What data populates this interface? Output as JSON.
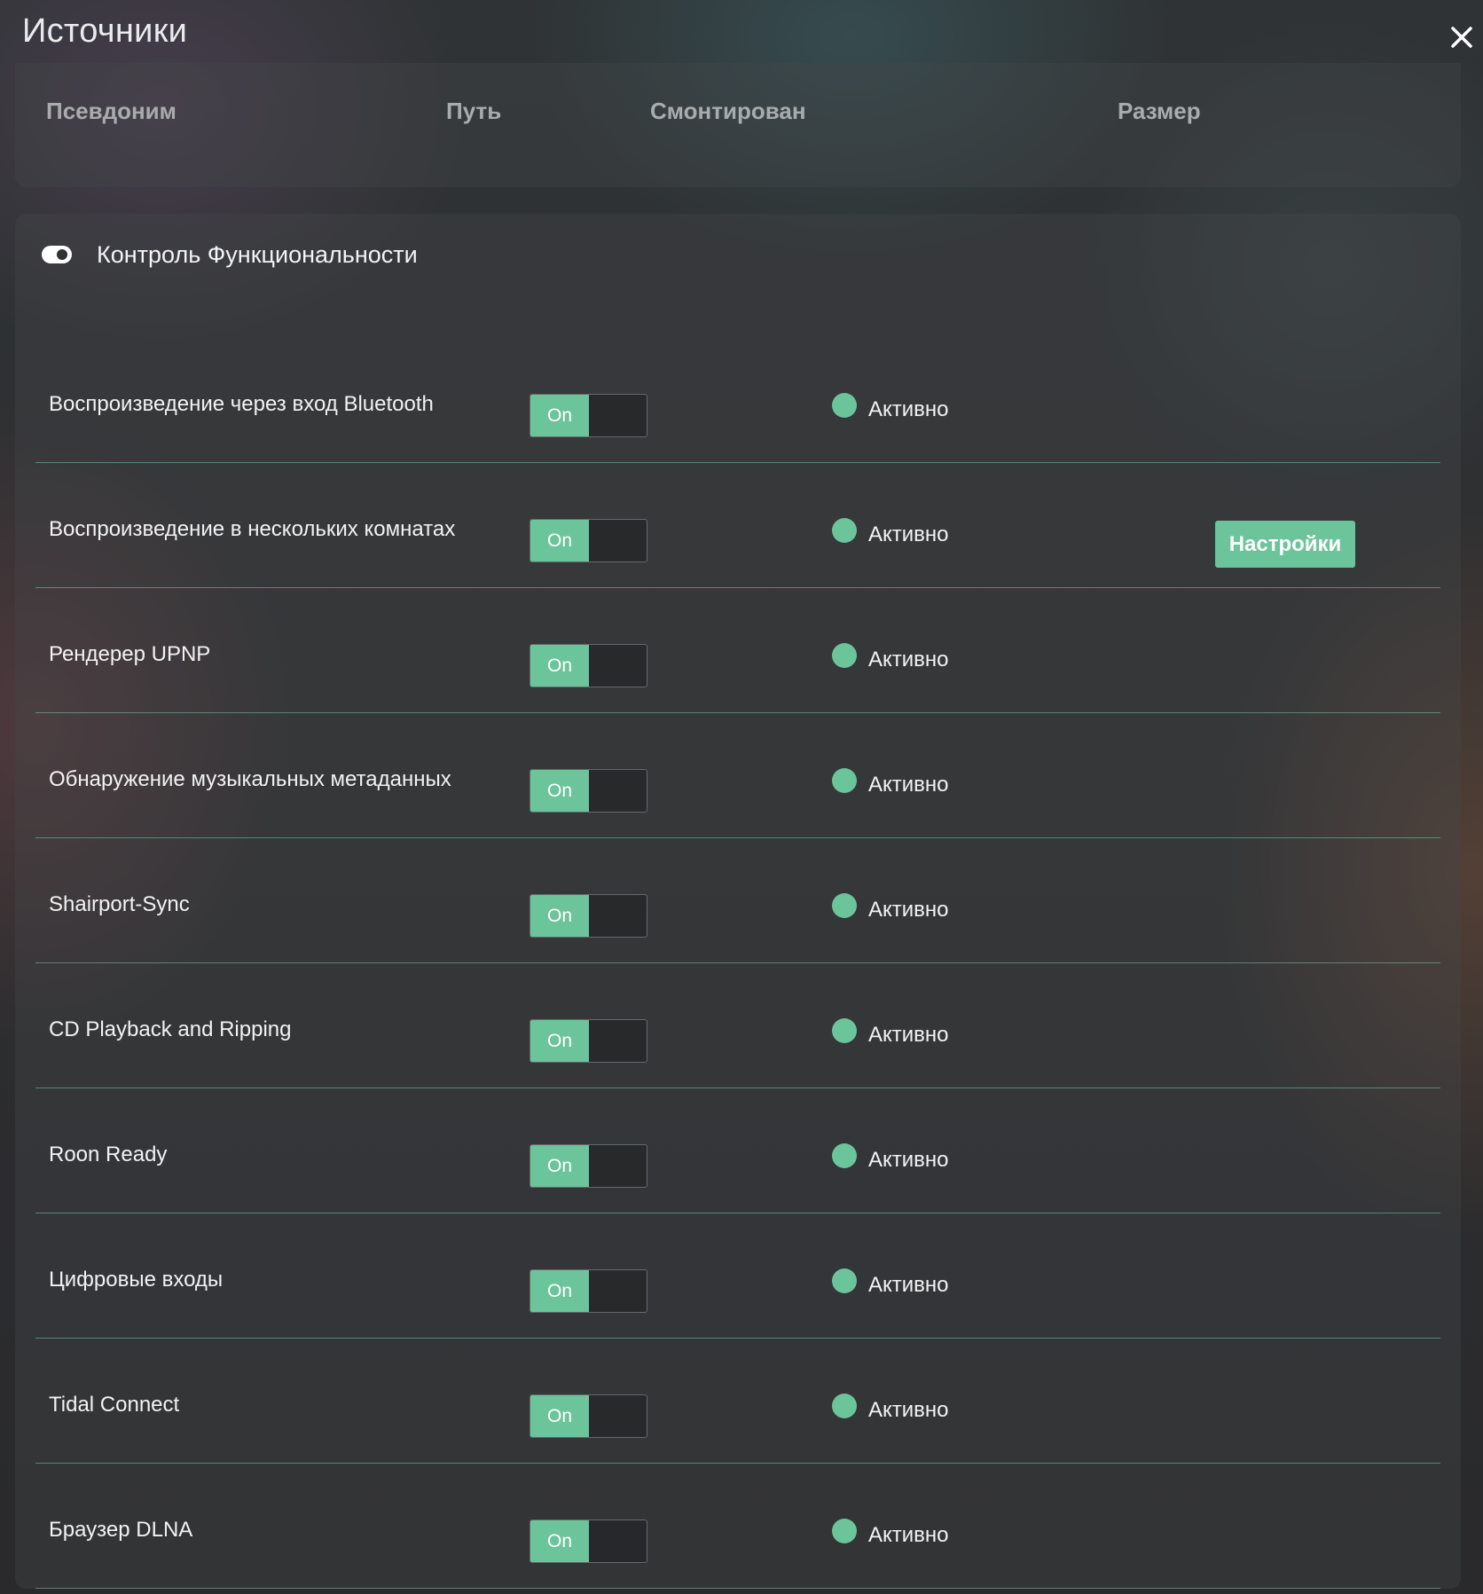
{
  "window": {
    "title": "Источники",
    "close_icon": "close-icon"
  },
  "sources_table": {
    "columns": [
      "Псевдоним",
      "Путь",
      "Смонтирован",
      "Размер"
    ]
  },
  "functionality": {
    "title": "Контроль Функциональности",
    "header_icon": "toggle-icon",
    "accent_color": "#6cc49b",
    "rows": [
      {
        "label": "Воспроизведение через вход Bluetooth",
        "switch": "On",
        "status": "Активно"
      },
      {
        "label": "Воспроизведение в нескольких комнатах",
        "switch": "On",
        "status": "Активно",
        "button": "Настройки"
      },
      {
        "label": "Рендерер UPNP",
        "switch": "On",
        "status": "Активно"
      },
      {
        "label": "Обнаружение музыкальных метаданных",
        "switch": "On",
        "status": "Активно"
      },
      {
        "label": "Shairport-Sync",
        "switch": "On",
        "status": "Активно"
      },
      {
        "label": "CD Playback and Ripping",
        "switch": "On",
        "status": "Активно"
      },
      {
        "label": "Roon Ready",
        "switch": "On",
        "status": "Активно"
      },
      {
        "label": "Цифровые входы",
        "switch": "On",
        "status": "Активно"
      },
      {
        "label": "Tidal Connect",
        "switch": "On",
        "status": "Активно"
      },
      {
        "label": "Браузер DLNA",
        "switch": "On",
        "status": "Активно"
      }
    ]
  }
}
